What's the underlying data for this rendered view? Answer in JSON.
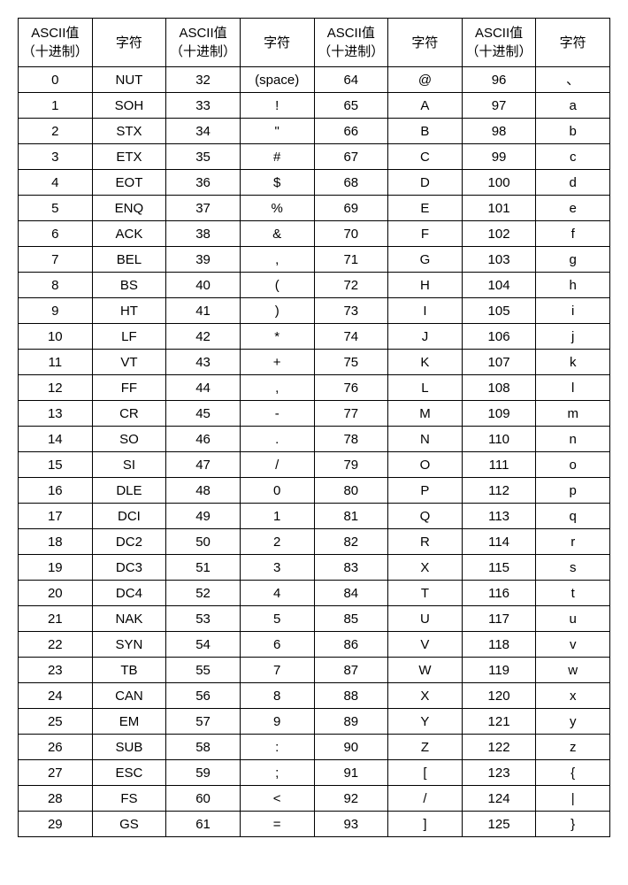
{
  "headers": {
    "ascii_value": "ASCII值（十进制）",
    "char": "字符"
  },
  "chart_data": {
    "type": "table",
    "title": "ASCII码表",
    "columns": [
      "ASCII值（十进制）",
      "字符",
      "ASCII值（十进制）",
      "字符",
      "ASCII值（十进制）",
      "字符",
      "ASCII值（十进制）",
      "字符"
    ],
    "rows": [
      [
        "0",
        "NUT",
        "32",
        "(space)",
        "64",
        "@",
        "96",
        "、"
      ],
      [
        "1",
        "SOH",
        "33",
        "!",
        "65",
        "A",
        "97",
        "a"
      ],
      [
        "2",
        "STX",
        "34",
        "\"",
        "66",
        "B",
        "98",
        "b"
      ],
      [
        "3",
        "ETX",
        "35",
        "#",
        "67",
        "C",
        "99",
        "c"
      ],
      [
        "4",
        "EOT",
        "36",
        "$",
        "68",
        "D",
        "100",
        "d"
      ],
      [
        "5",
        "ENQ",
        "37",
        "%",
        "69",
        "E",
        "101",
        "e"
      ],
      [
        "6",
        "ACK",
        "38",
        "&",
        "70",
        "F",
        "102",
        "f"
      ],
      [
        "7",
        "BEL",
        "39",
        ",",
        "71",
        "G",
        "103",
        "g"
      ],
      [
        "8",
        "BS",
        "40",
        "(",
        "72",
        "H",
        "104",
        "h"
      ],
      [
        "9",
        "HT",
        "41",
        ")",
        "73",
        "I",
        "105",
        "i"
      ],
      [
        "10",
        "LF",
        "42",
        "*",
        "74",
        "J",
        "106",
        "j"
      ],
      [
        "11",
        "VT",
        "43",
        "+",
        "75",
        "K",
        "107",
        "k"
      ],
      [
        "12",
        "FF",
        "44",
        ",",
        "76",
        "L",
        "108",
        "l"
      ],
      [
        "13",
        "CR",
        "45",
        "-",
        "77",
        "M",
        "109",
        "m"
      ],
      [
        "14",
        "SO",
        "46",
        ".",
        "78",
        "N",
        "110",
        "n"
      ],
      [
        "15",
        "SI",
        "47",
        "/",
        "79",
        "O",
        "111",
        "o"
      ],
      [
        "16",
        "DLE",
        "48",
        "0",
        "80",
        "P",
        "112",
        "p"
      ],
      [
        "17",
        "DCI",
        "49",
        "1",
        "81",
        "Q",
        "113",
        "q"
      ],
      [
        "18",
        "DC2",
        "50",
        "2",
        "82",
        "R",
        "114",
        "r"
      ],
      [
        "19",
        "DC3",
        "51",
        "3",
        "83",
        "X",
        "115",
        "s"
      ],
      [
        "20",
        "DC4",
        "52",
        "4",
        "84",
        "T",
        "116",
        "t"
      ],
      [
        "21",
        "NAK",
        "53",
        "5",
        "85",
        "U",
        "117",
        "u"
      ],
      [
        "22",
        "SYN",
        "54",
        "6",
        "86",
        "V",
        "118",
        "v"
      ],
      [
        "23",
        "TB",
        "55",
        "7",
        "87",
        "W",
        "119",
        "w"
      ],
      [
        "24",
        "CAN",
        "56",
        "8",
        "88",
        "X",
        "120",
        "x"
      ],
      [
        "25",
        "EM",
        "57",
        "9",
        "89",
        "Y",
        "121",
        "y"
      ],
      [
        "26",
        "SUB",
        "58",
        ":",
        "90",
        "Z",
        "122",
        "z"
      ],
      [
        "27",
        "ESC",
        "59",
        ";",
        "91",
        "[",
        "123",
        "{"
      ],
      [
        "28",
        "FS",
        "60",
        "<",
        "92",
        "/",
        "124",
        "|"
      ],
      [
        "29",
        "GS",
        "61",
        "=",
        "93",
        "]",
        "125",
        "}"
      ]
    ]
  }
}
